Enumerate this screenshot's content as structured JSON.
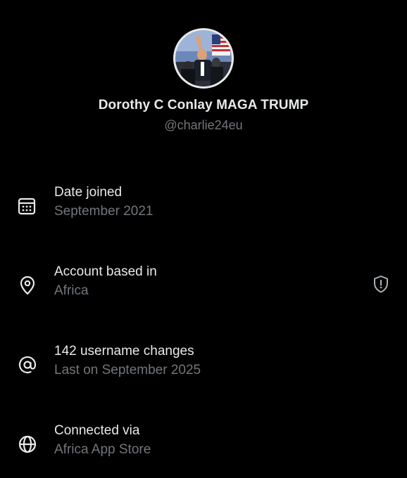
{
  "profile": {
    "display_name": "Dorothy C Conlay MAGA TRUMP",
    "handle": "@charlie24eu",
    "avatar_icon": "profile-photo"
  },
  "details": [
    {
      "icon": "calendar-icon",
      "label": "Date joined",
      "value": "September 2021"
    },
    {
      "icon": "location-pin-icon",
      "label": "Account based in",
      "value": "Africa",
      "trailing_icon": "shield-alert-icon"
    },
    {
      "icon": "at-sign-icon",
      "label": "142 username changes",
      "value": "Last on September 2025"
    },
    {
      "icon": "globe-icon",
      "label": "Connected via",
      "value": "Africa App Store"
    }
  ],
  "colors": {
    "background": "#000000",
    "primary_text": "#e7e9ea",
    "secondary_text": "#71767b"
  }
}
